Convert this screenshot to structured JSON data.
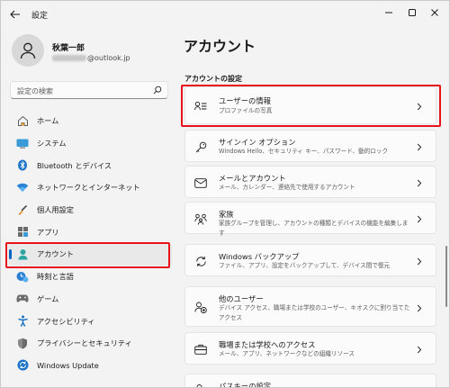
{
  "window": {
    "title": "設定"
  },
  "profile": {
    "name": "秋葉一郎",
    "email_suffix": "@outlook.jp"
  },
  "search": {
    "placeholder": "設定の検索"
  },
  "sidebar": {
    "items": [
      {
        "label": "ホーム",
        "icon": "home-icon"
      },
      {
        "label": "システム",
        "icon": "system-icon"
      },
      {
        "label": "Bluetooth とデバイス",
        "icon": "bluetooth-icon"
      },
      {
        "label": "ネットワークとインターネット",
        "icon": "network-icon"
      },
      {
        "label": "個人用設定",
        "icon": "personalization-icon"
      },
      {
        "label": "アプリ",
        "icon": "apps-icon"
      },
      {
        "label": "アカウント",
        "icon": "accounts-icon",
        "active": true
      },
      {
        "label": "時刻と言語",
        "icon": "time-language-icon"
      },
      {
        "label": "ゲーム",
        "icon": "gaming-icon"
      },
      {
        "label": "アクセシビリティ",
        "icon": "accessibility-icon"
      },
      {
        "label": "プライバシーとセキュリティ",
        "icon": "privacy-icon"
      },
      {
        "label": "Windows Update",
        "icon": "windows-update-icon"
      }
    ]
  },
  "main": {
    "title": "アカウント",
    "section_title": "アカウントの設定",
    "cards": [
      {
        "title": "ユーザーの情報",
        "subtitle": "プロファイルの写真",
        "icon": "user-info-icon"
      },
      {
        "title": "サインイン オプション",
        "subtitle": "Windows Hello、セキュリティ キー、パスワード、動的ロック",
        "icon": "key-icon"
      },
      {
        "title": "メールとアカウント",
        "subtitle": "メール、カレンダー、連絡先で使用するアカウント",
        "icon": "mail-icon"
      },
      {
        "title": "家族",
        "subtitle": "家族グループを管理し、アカウントの種類とデバイスの機能を編集します",
        "icon": "family-icon"
      },
      {
        "title": "Windows バックアップ",
        "subtitle": "ファイル、アプリ、設定をバックアップして、デバイス間で復元",
        "icon": "backup-icon"
      },
      {
        "title": "他のユーザー",
        "subtitle": "デバイス アクセス、職場または学校のユーザー、キオスクに割り当てたアクセス",
        "icon": "other-users-icon"
      },
      {
        "title": "職場または学校へのアクセス",
        "subtitle": "メール、アプリ、ネットワークなどの組織リソース",
        "icon": "work-access-icon"
      },
      {
        "title": "パスキーの設定",
        "subtitle": "",
        "icon": "passkey-icon"
      }
    ]
  },
  "colors": {
    "accent": "#0067c0",
    "highlight": "#e8131a"
  }
}
